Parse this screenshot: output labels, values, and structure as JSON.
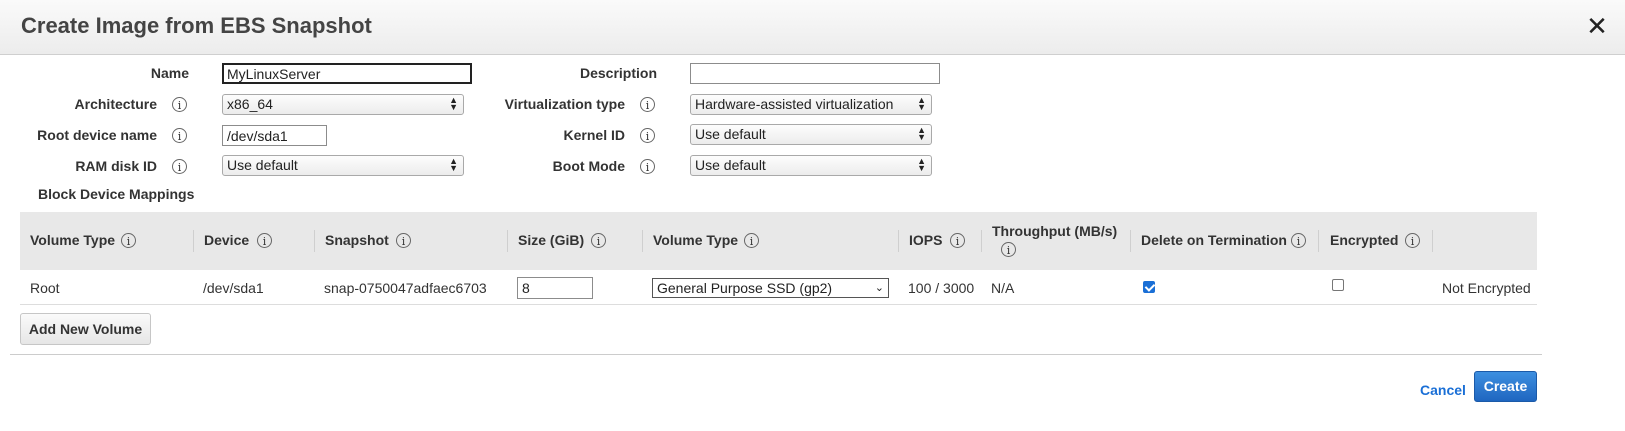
{
  "dialog": {
    "title": "Create Image from EBS Snapshot",
    "close_glyph": "✕",
    "info_glyph": "i"
  },
  "form": {
    "name": {
      "label": "Name",
      "value": "MyLinuxServer"
    },
    "description": {
      "label": "Description",
      "value": ""
    },
    "architecture": {
      "label": "Architecture",
      "value": "x86_64"
    },
    "virtualization_type": {
      "label": "Virtualization type",
      "value": "Hardware-assisted virtualization"
    },
    "root_device_name": {
      "label": "Root device name",
      "value": "/dev/sda1"
    },
    "kernel_id": {
      "label": "Kernel ID",
      "value": "Use default"
    },
    "ram_disk_id": {
      "label": "RAM disk ID",
      "value": "Use default"
    },
    "boot_mode": {
      "label": "Boot Mode",
      "value": "Use default"
    }
  },
  "block_device_mappings": {
    "label": "Block Device Mappings",
    "columns": [
      "Volume Type",
      "Device",
      "Snapshot",
      "Size (GiB)",
      "Volume Type",
      "IOPS",
      "Throughput (MB/s)",
      "Delete on Termination",
      "Encrypted"
    ],
    "rows": [
      {
        "volume_type": "Root",
        "device": "/dev/sda1",
        "snapshot": "snap-0750047adfaec6703",
        "size": "8",
        "ebs_volume_type": "General Purpose SSD (gp2)",
        "iops": "100 / 3000",
        "throughput": "N/A",
        "delete_on_termination": true,
        "encrypted": false,
        "encryption_status": "Not Encrypted"
      }
    ],
    "add_button": "Add New Volume"
  },
  "footer": {
    "cancel": "Cancel",
    "create": "Create"
  },
  "colors": {
    "accent": "#1a6fd6",
    "create_button": "#2a76cf"
  }
}
